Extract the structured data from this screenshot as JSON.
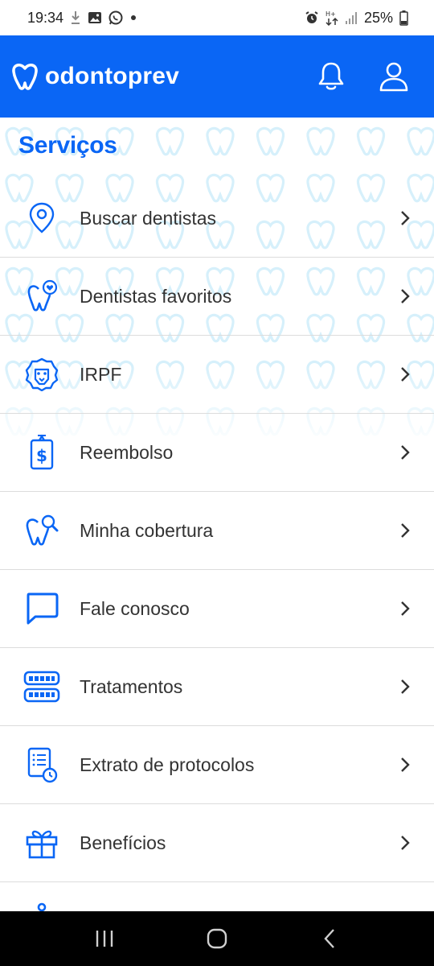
{
  "status_bar": {
    "time": "19:34",
    "battery": "25%",
    "icons": [
      "download-icon",
      "image-icon",
      "whatsapp-icon",
      "dot-icon",
      "alarm-icon",
      "data-arrows-icon",
      "signal-icon",
      "battery-icon"
    ]
  },
  "header": {
    "brand": "odontoprev",
    "logo_icon": "tooth-heart-logo-icon",
    "actions": [
      "bell-icon",
      "user-icon"
    ]
  },
  "main": {
    "title": "Serviços",
    "items": [
      {
        "label": "Buscar dentistas",
        "icon": "map-pin-icon"
      },
      {
        "label": "Dentistas favoritos",
        "icon": "tooth-heart-icon"
      },
      {
        "label": "IRPF",
        "icon": "lion-icon"
      },
      {
        "label": "Reembolso",
        "icon": "receipt-dollar-icon"
      },
      {
        "label": "Minha cobertura",
        "icon": "tooth-search-icon"
      },
      {
        "label": "Fale conosco",
        "icon": "chat-bubble-icon"
      },
      {
        "label": "Tratamentos",
        "icon": "teeth-icon"
      },
      {
        "label": "Extrato de protocolos",
        "icon": "document-clock-icon"
      },
      {
        "label": "Benefícios",
        "icon": "gift-icon"
      }
    ]
  },
  "nav": [
    "recent-apps-icon",
    "home-icon",
    "back-icon"
  ],
  "colors": {
    "brand": "#0a66f5",
    "pattern": "#d6f0fb",
    "divider": "#dcdcdc"
  }
}
